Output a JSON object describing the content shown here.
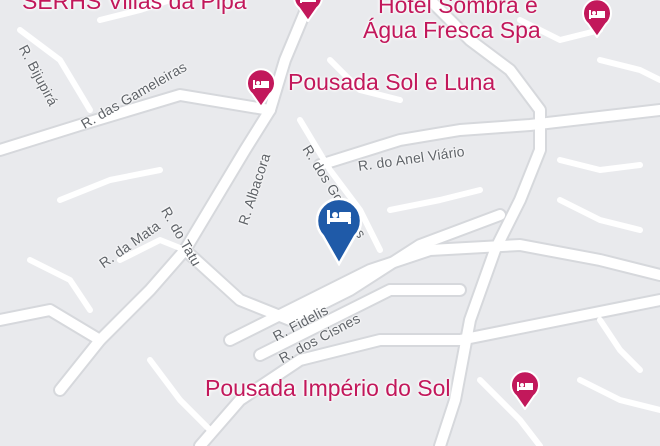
{
  "map": {
    "colors": {
      "background": "#e9eaed",
      "road": "#ffffff",
      "road_border": "#d6d8dc",
      "poi": "#c2185b",
      "selected_pin": "#1f5aa8",
      "road_label": "#5f6368"
    },
    "selected_marker": {
      "icon": "hotel-bed-icon",
      "color": "#1f5aa8"
    },
    "pois": [
      {
        "name": "SERHS Villas da Pipa",
        "icon": "hotel-bed-icon"
      },
      {
        "name": "Hotel Sombra e",
        "icon": "hotel-bed-icon"
      },
      {
        "name": "Água Fresca Spa"
      },
      {
        "name": "Pousada Sol e Luna",
        "icon": "hotel-bed-icon"
      },
      {
        "name": "Pousada Império do Sol",
        "icon": "hotel-bed-icon"
      }
    ],
    "streets": [
      "R. Bijupirá",
      "R. das Gameleiras",
      "R. do Anel Viário",
      "R. dos Golfinhos",
      "R. Albacora",
      "R. da Mata",
      "R. do Tatu",
      "R. Fidelis",
      "R. dos Cisnes"
    ]
  }
}
